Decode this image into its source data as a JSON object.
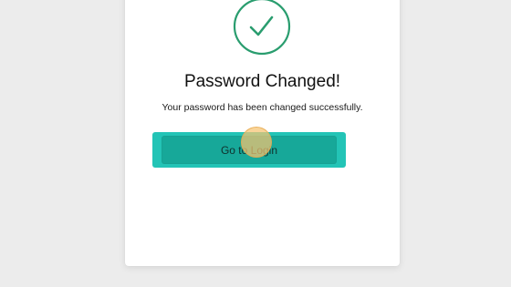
{
  "success_dialog": {
    "icon": "check-circle-icon",
    "title": "Password Changed!",
    "message": "Your password has been changed successfully.",
    "button_label": "Go to Login"
  },
  "colors": {
    "background": "#ececec",
    "card": "#ffffff",
    "check_icon": "#2a9d6f",
    "button_outer": "#23c4b6",
    "button_inner": "#17a899",
    "click_marker": "#f7c470"
  }
}
